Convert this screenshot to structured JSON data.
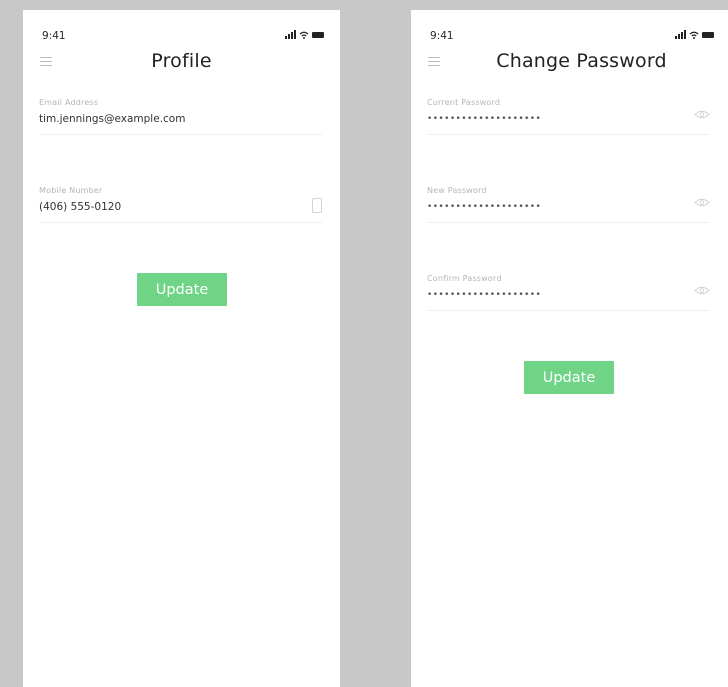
{
  "colors": {
    "accent": "#6fd485",
    "page_background": "#c8c8c8",
    "screen_background": "#ffffff"
  },
  "profile_screen": {
    "status_bar": {
      "time": "9:41"
    },
    "title": "Profile",
    "menu_icon": "hamburger-menu-icon",
    "fields": [
      {
        "label": "Email Address",
        "value": "tim.jennings@example.com"
      },
      {
        "label": "Mobile Number",
        "value": "(406) 555-0120",
        "icon": "phone-icon"
      }
    ],
    "update_label": "Update"
  },
  "password_screen": {
    "status_bar": {
      "time": "9:41"
    },
    "title": "Change Password",
    "menu_icon": "hamburger-menu-icon",
    "fields": [
      {
        "label": "Current Password",
        "value": "••••••••••••••••••••",
        "icon": "eye-icon"
      },
      {
        "label": "New Password",
        "value": "••••••••••••••••••••",
        "icon": "eye-icon"
      },
      {
        "label": "Confirm Password",
        "value": "••••••••••••••••••••",
        "icon": "eye-icon"
      }
    ],
    "update_label": "Update"
  }
}
